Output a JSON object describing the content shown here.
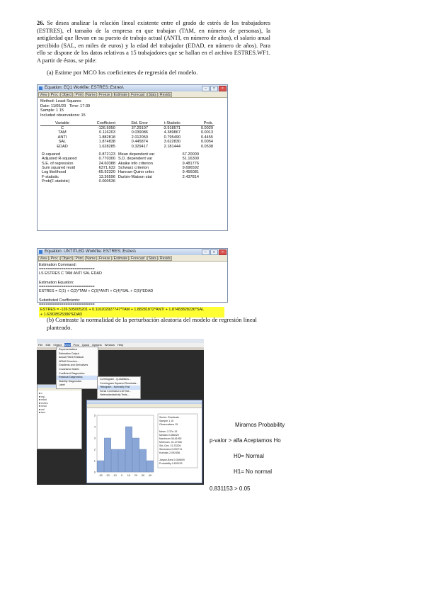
{
  "question": {
    "number": "26.",
    "text": "Se desea analizar la relación lineal existente entre el grado de estrés de los trabajadores (ESTRES), el tamaño de la empresa en que trabajan (TAM, en número de personas), la antigüedad que llevan en su puesto de trabajo actual (ANTI, en número de años), el salario anual percibido (SAL, en miles de euros) y la edad del trabajador (EDAD, en número de años). Para ello se dispone de los datos relativos a 15 trabajadores que se hallan en el archivo ESTRES.WF1. A partir de éstos, se pide:",
    "a": "(a) Estime por MCO los coeficientes de regresión del modelo.",
    "b": "(b) Contraste la normalidad de la perturbación aleatoria del modelo de regresión lineal planteado."
  },
  "eq_window": {
    "title": "Equation: EQ1  Workfile: ESTRES::Estres\\",
    "toolbar": [
      "View",
      "Proc",
      "Object",
      "Print",
      "Name",
      "Freeze",
      "Estimate",
      "Forecast",
      "Stats",
      "Resids"
    ],
    "header_lines": [
      "Method: Least Squares",
      "Date: 11/05/20   Time: 17:39",
      "Sample: 1 15",
      "Included observations: 15"
    ],
    "columns": [
      "Variable",
      "Coefficient",
      "Std. Error",
      "t-Statistic",
      "Prob."
    ],
    "rows": [
      [
        "C",
        "-126.5050",
        "37.29107",
        "-3.918571",
        "0.0029"
      ],
      [
        "TAM",
        "0.116203",
        "0.039086",
        "4.389867",
        "0.0013"
      ],
      [
        "ANTI",
        "1.882818",
        "2.012050",
        "0.795490",
        "0.4455"
      ],
      [
        "SAL",
        "1.874838",
        "0.445874",
        "3.622830",
        "0.0054"
      ],
      [
        "EDAD",
        "1.628285",
        "0.329417",
        "2.181444",
        "0.0538"
      ]
    ],
    "stats": [
      [
        "R-squared",
        "0.872123",
        "Mean dependent var",
        "67.20000"
      ],
      [
        "Adjusted R-squared",
        "0.770300",
        "S.D. dependent var",
        "51.16300"
      ],
      [
        "S.E. of regression",
        "24.60388",
        "Akaike info criterion",
        "9.481776"
      ],
      [
        "Sum squared resid",
        "6371.632",
        "Schwarz criterion",
        "9.696592"
      ],
      [
        "Log likelihood",
        "-65.92320",
        "Hannan-Quinn criter.",
        "9.456081"
      ],
      [
        "F-statistic",
        "13.36596",
        "Durbin-Watson stat",
        "2.437814"
      ],
      [
        "Prob(F-statistic)",
        "0.000536",
        "",
        ""
      ]
    ]
  },
  "rep_window": {
    "title": "Equation: UNTITLED   Workfile: ESTRES::Estres\\",
    "toolbar": [
      "View",
      "Proc",
      "Object",
      "Print",
      "Name",
      "Freeze",
      "Estimate",
      "Forecast",
      "Stats",
      "Resids"
    ],
    "lines": [
      "Estimation Command:",
      "=========================",
      "LS ESTRES C TAM ANTI SAL EDAD",
      "",
      "Estimation Equation:",
      "=========================",
      "ESTRES = C(1) + C(2)*TAM + C(3)*ANTI + C(4)*SAL + C(5)*EDAD",
      "",
      "Substituted Coefficients:",
      "========================="
    ],
    "highlight": [
      "ESTRES = -126.505005201 + 0.116202927747*TAM + 1.88281872*ANTI + 1.87483828236*SAL",
      "+ 1.62828525386*EDAD"
    ]
  },
  "screenshot2": {
    "menubar": [
      "File",
      "Edit",
      "Object",
      "View",
      "Proc",
      "Quick",
      "Options",
      "Window",
      "Help"
    ],
    "menu_items": [
      "Representations",
      "Estimation Output",
      "Actual,Fitted,Residual",
      "ARMA Structure...",
      "Gradients and Derivatives",
      "Covariance Matrix",
      "Coefficient Diagnostics",
      "Residual Diagnostics",
      "Stability Diagnostics",
      "Label"
    ],
    "submenu_items": [
      "Correlogram - Q-statistics...",
      "Correlogram Squared Residuals...",
      "Histogram - Normality Test",
      "Serial Correlation LM Test...",
      "Heteroskedasticity Tests..."
    ],
    "hist_bars": [
      1,
      3,
      2,
      2,
      4,
      3,
      2,
      1
    ],
    "hist_ticks": [
      "-30",
      "-20",
      "-10",
      "0",
      "10",
      "20",
      "30",
      "40"
    ],
    "hist_yticks": [
      "0",
      "1",
      "2",
      "3",
      "4",
      "5"
    ],
    "stats_box": [
      "Series: Residuals",
      "Sample 1 15",
      "Observations 15",
      "",
      "Mean   -2.37e-15",
      "Median   0.658420",
      "Maximum   38.81952",
      "Minimum  -31.27306",
      "Std. Dev.   21.33326",
      "Skewness   0.030711",
      "Kurtosis   2.092458",
      "",
      "Jarque-Bera  0.369609",
      "Probability  0.831153"
    ]
  },
  "notes": {
    "line1": "Miramos Probability",
    "line2": "p-valor > alfa Aceptamos Ho",
    "line3": "H0= Normal",
    "line4": "H1= No normal",
    "line5": "0.831153 > 0.05"
  }
}
